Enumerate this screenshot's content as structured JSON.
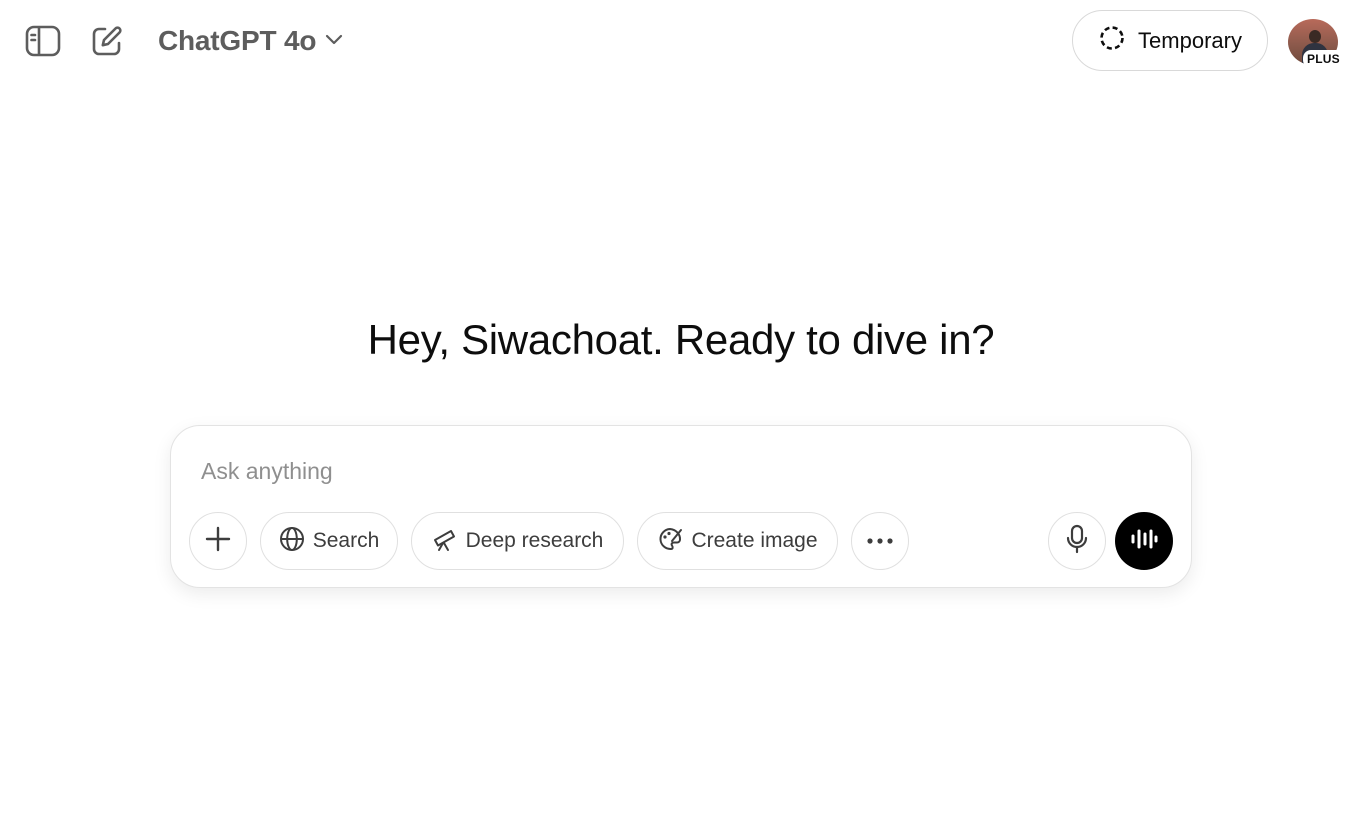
{
  "header": {
    "sidebar_toggle_icon": "sidebar-toggle-icon",
    "new_chat_icon": "new-chat-icon",
    "model_name": "ChatGPT 4o",
    "model_chevron_icon": "chevron-down-icon",
    "temporary_label": "Temporary",
    "temporary_icon": "dashed-circle-icon",
    "plan_badge": "PLUS"
  },
  "main": {
    "greeting": "Hey, Siwachoat. Ready to dive in?"
  },
  "composer": {
    "placeholder": "Ask anything",
    "value": "",
    "tools": [
      {
        "label": "Search",
        "icon": "globe-icon"
      },
      {
        "label": "Deep research",
        "icon": "telescope-icon"
      },
      {
        "label": "Create image",
        "icon": "palette-icon"
      }
    ],
    "add_icon": "plus-icon",
    "more_icon": "more-horizontal-icon",
    "mic_icon": "microphone-icon",
    "voice_icon": "voice-waveform-icon"
  },
  "colors": {
    "accent": "#000000",
    "text": "#0d0d0d",
    "muted": "#5d5d5d",
    "placeholder": "#8f8f8f",
    "border": "#e0e0e0"
  }
}
